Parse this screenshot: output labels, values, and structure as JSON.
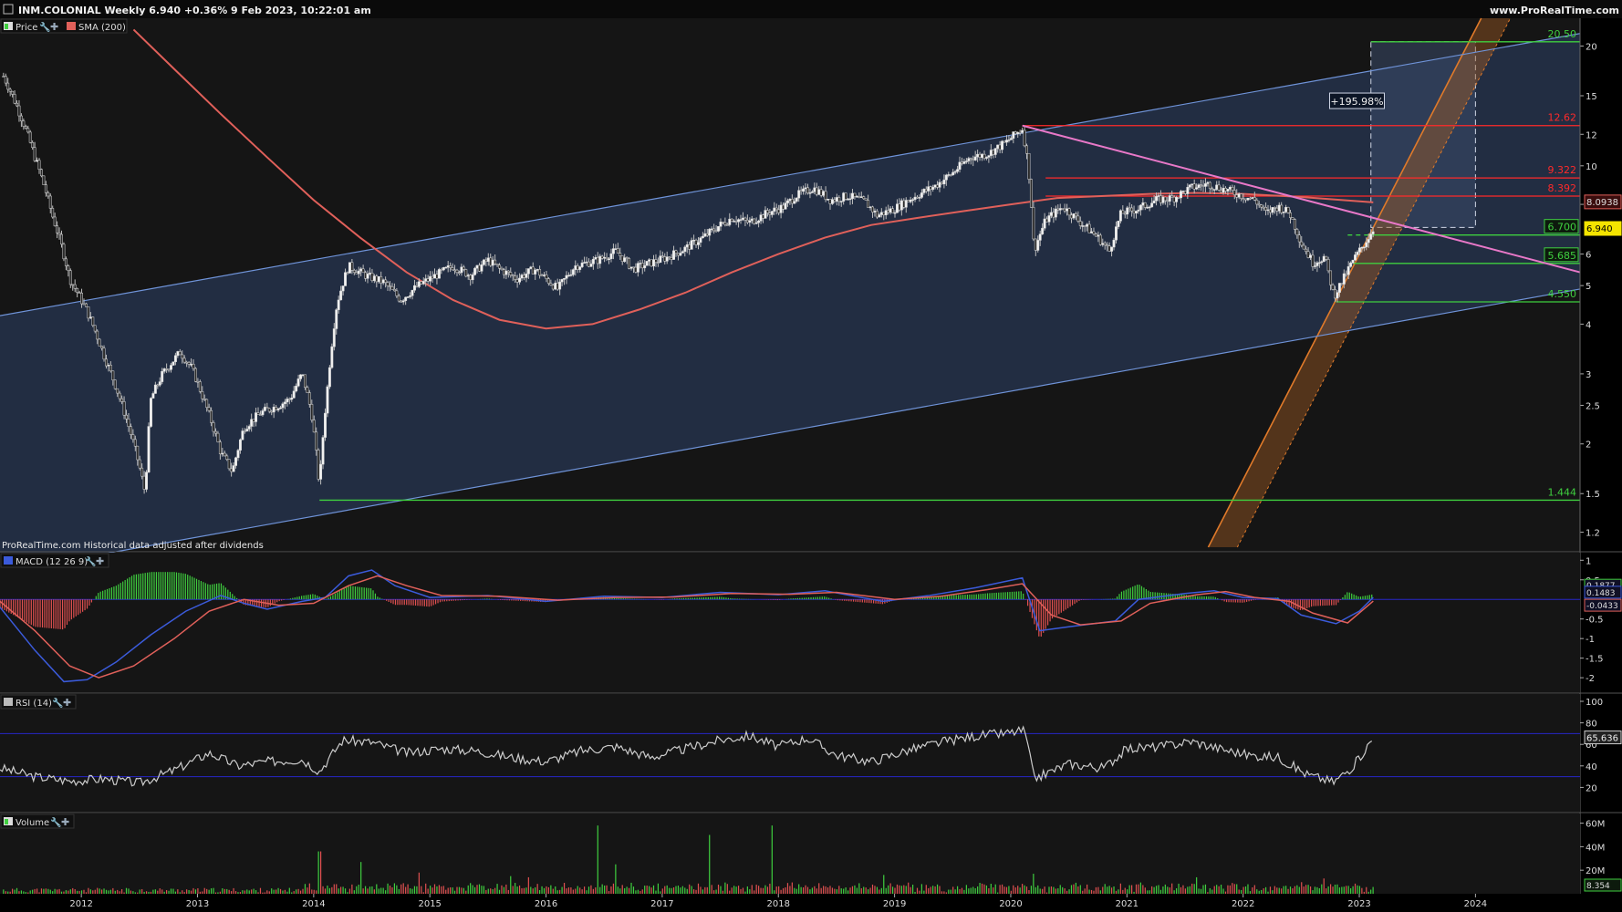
{
  "header": {
    "title": "INM.COLONIAL Weekly 6.940 +0.36% 9 Feb 2023, 10:22:01 am",
    "brand": "www.ProRealTime.com",
    "footnote": "ProRealTime.com  Historical data adjusted after dividends"
  },
  "colors": {
    "background": "#000000",
    "panel": "#151515",
    "channel_fill": "#243047",
    "channel_line": "#6f93d8",
    "sma": "#e0605a",
    "resistance": "#ff2a2a",
    "support": "#3fcf3f",
    "downtrend": "#e878c8",
    "uptrend": "#e07a2a",
    "price": "#e8e8e8",
    "macd": "#3b5bdb",
    "signal": "#e0605a",
    "rsi": "#cccccc",
    "band": "#2626c8"
  },
  "panels": [
    {
      "id": "price",
      "legend": [
        "Price",
        "SMA (200)"
      ]
    },
    {
      "id": "macd",
      "legend": [
        "MACD (12 26 9)"
      ]
    },
    {
      "id": "rsi",
      "legend": [
        "RSI (14)"
      ]
    },
    {
      "id": "volume",
      "legend": [
        "Volume"
      ]
    }
  ],
  "chart_data": [
    {
      "type": "candlestick",
      "panel": "price",
      "scale": "log",
      "ylim": [
        1.1,
        23
      ],
      "y_ticks": [
        1.2,
        1.5,
        2,
        2.5,
        3,
        4,
        5,
        6,
        8,
        10,
        12,
        15,
        20
      ],
      "x_ticks": [
        "2012",
        "2013",
        "2014",
        "2015",
        "2016",
        "2017",
        "2018",
        "2019",
        "2020",
        "2021",
        "2022",
        "2023",
        "2024"
      ],
      "x_range": [
        2011.3,
        2024.9
      ],
      "price_series": [
        [
          2011.33,
          16.8
        ],
        [
          2011.45,
          14.0
        ],
        [
          2011.6,
          10.5
        ],
        [
          2011.75,
          7.5
        ],
        [
          2011.9,
          5.2
        ],
        [
          2012.05,
          4.3
        ],
        [
          2012.2,
          3.3
        ],
        [
          2012.35,
          2.5
        ],
        [
          2012.45,
          2.0
        ],
        [
          2012.55,
          1.5
        ],
        [
          2012.6,
          2.6
        ],
        [
          2012.7,
          3.0
        ],
        [
          2012.85,
          3.4
        ],
        [
          2012.95,
          3.1
        ],
        [
          2013.05,
          2.6
        ],
        [
          2013.2,
          1.9
        ],
        [
          2013.3,
          1.7
        ],
        [
          2013.4,
          2.2
        ],
        [
          2013.55,
          2.4
        ],
        [
          2013.7,
          2.5
        ],
        [
          2013.8,
          2.6
        ],
        [
          2013.9,
          3.0
        ],
        [
          2013.98,
          2.4
        ],
        [
          2014.05,
          1.55
        ],
        [
          2014.12,
          2.8
        ],
        [
          2014.2,
          4.5
        ],
        [
          2014.3,
          5.6
        ],
        [
          2014.45,
          5.3
        ],
        [
          2014.6,
          5.1
        ],
        [
          2014.75,
          4.6
        ],
        [
          2014.9,
          5.0
        ],
        [
          2015.05,
          5.3
        ],
        [
          2015.2,
          5.6
        ],
        [
          2015.35,
          5.3
        ],
        [
          2015.5,
          5.8
        ],
        [
          2015.6,
          5.5
        ],
        [
          2015.75,
          5.2
        ],
        [
          2015.9,
          5.5
        ],
        [
          2016.1,
          4.9
        ],
        [
          2016.25,
          5.6
        ],
        [
          2016.45,
          5.8
        ],
        [
          2016.6,
          6.1
        ],
        [
          2016.75,
          5.5
        ],
        [
          2016.9,
          5.7
        ],
        [
          2017.05,
          5.9
        ],
        [
          2017.2,
          6.2
        ],
        [
          2017.35,
          6.6
        ],
        [
          2017.5,
          7.1
        ],
        [
          2017.6,
          7.4
        ],
        [
          2017.75,
          7.2
        ],
        [
          2017.9,
          7.6
        ],
        [
          2018.05,
          7.9
        ],
        [
          2018.15,
          8.4
        ],
        [
          2018.3,
          8.8
        ],
        [
          2018.45,
          8.2
        ],
        [
          2018.6,
          8.4
        ],
        [
          2018.75,
          8.1
        ],
        [
          2018.85,
          7.5
        ],
        [
          2019.0,
          7.8
        ],
        [
          2019.15,
          8.3
        ],
        [
          2019.35,
          8.9
        ],
        [
          2019.5,
          9.6
        ],
        [
          2019.65,
          10.5
        ],
        [
          2019.8,
          10.7
        ],
        [
          2019.95,
          11.4
        ],
        [
          2020.1,
          12.4
        ],
        [
          2020.15,
          10.0
        ],
        [
          2020.2,
          6.1
        ],
        [
          2020.3,
          7.3
        ],
        [
          2020.45,
          7.9
        ],
        [
          2020.6,
          7.2
        ],
        [
          2020.75,
          6.6
        ],
        [
          2020.85,
          6.1
        ],
        [
          2020.95,
          7.6
        ],
        [
          2021.1,
          7.8
        ],
        [
          2021.25,
          8.2
        ],
        [
          2021.4,
          8.3
        ],
        [
          2021.55,
          8.8
        ],
        [
          2021.7,
          9.0
        ],
        [
          2021.85,
          8.7
        ],
        [
          2022.0,
          8.4
        ],
        [
          2022.1,
          8.2
        ],
        [
          2022.2,
          7.6
        ],
        [
          2022.3,
          7.9
        ],
        [
          2022.4,
          7.6
        ],
        [
          2022.5,
          6.4
        ],
        [
          2022.6,
          5.7
        ],
        [
          2022.7,
          5.9
        ],
        [
          2022.78,
          4.7
        ],
        [
          2022.85,
          5.1
        ],
        [
          2022.95,
          5.8
        ],
        [
          2023.05,
          6.4
        ],
        [
          2023.12,
          6.94
        ]
      ],
      "sma_200": [
        [
          2012.45,
          22.0
        ],
        [
          2012.8,
          17.5
        ],
        [
          2013.2,
          13.5
        ],
        [
          2013.6,
          10.5
        ],
        [
          2014.0,
          8.2
        ],
        [
          2014.4,
          6.6
        ],
        [
          2014.8,
          5.4
        ],
        [
          2015.2,
          4.6
        ],
        [
          2015.6,
          4.1
        ],
        [
          2016.0,
          3.9
        ],
        [
          2016.4,
          4.0
        ],
        [
          2016.8,
          4.35
        ],
        [
          2017.2,
          4.8
        ],
        [
          2017.6,
          5.4
        ],
        [
          2018.0,
          6.0
        ],
        [
          2018.4,
          6.6
        ],
        [
          2018.8,
          7.1
        ],
        [
          2019.2,
          7.4
        ],
        [
          2019.6,
          7.7
        ],
        [
          2020.0,
          8.0
        ],
        [
          2020.4,
          8.3
        ],
        [
          2020.8,
          8.4
        ],
        [
          2021.2,
          8.5
        ],
        [
          2021.6,
          8.55
        ],
        [
          2022.0,
          8.5
        ],
        [
          2022.5,
          8.35
        ],
        [
          2023.12,
          8.0938
        ]
      ],
      "horizontal_levels": [
        {
          "value": 20.5,
          "label": "20.50",
          "kind": "support",
          "from": 2023.1
        },
        {
          "value": 12.62,
          "label": "12.62",
          "kind": "resistance",
          "from": 2020.1
        },
        {
          "value": 9.322,
          "label": "9.322",
          "kind": "resistance",
          "from": 2020.3
        },
        {
          "value": 8.392,
          "label": "8.392",
          "kind": "resistance",
          "from": 2020.3
        },
        {
          "value": 6.7,
          "label": "6.700",
          "kind": "support",
          "from": 2022.9,
          "dashed_until": 2023.1
        },
        {
          "value": 5.685,
          "label": "5.685",
          "kind": "support",
          "from": 2022.95
        },
        {
          "value": 4.55,
          "label": "4.550",
          "kind": "support",
          "from": 2022.8
        },
        {
          "value": 1.444,
          "label": "1.444",
          "kind": "support",
          "from": 2014.05
        }
      ],
      "price_tags": [
        {
          "value": 8.0938,
          "label": "8.0938",
          "style": "sma"
        },
        {
          "value": 6.94,
          "label": "6.940",
          "style": "last"
        }
      ],
      "channel": {
        "upper": [
          [
            2011.3,
            4.2
          ],
          [
            2024.9,
            21.5
          ]
        ],
        "lower": [
          [
            2011.3,
            0.95
          ],
          [
            2024.9,
            4.9
          ]
        ]
      },
      "downtrend_line": [
        [
          2020.1,
          12.62
        ],
        [
          2024.9,
          5.4
        ]
      ],
      "uptrend_band": {
        "left": [
          [
            2021.7,
            1.1
          ],
          [
            2024.05,
            23.5
          ]
        ],
        "right": [
          [
            2021.95,
            1.1
          ],
          [
            2024.3,
            23.5
          ]
        ]
      },
      "target_box": {
        "x0": 2023.1,
        "x1": 2024.0,
        "y0": 7.0,
        "y1": 20.5
      },
      "annotations": [
        {
          "text": "+195.98%",
          "x": 2022.98,
          "y": 14.3
        }
      ]
    },
    {
      "type": "macd",
      "panel": "macd",
      "ylim": [
        -2.3,
        1.1
      ],
      "y_ticks": [
        1,
        0.5,
        -0.5,
        -1,
        -1.5,
        -2
      ],
      "macd": [
        [
          2011.3,
          -0.2
        ],
        [
          2011.6,
          -1.3
        ],
        [
          2011.85,
          -2.1
        ],
        [
          2012.05,
          -2.05
        ],
        [
          2012.3,
          -1.6
        ],
        [
          2012.6,
          -0.9
        ],
        [
          2012.9,
          -0.3
        ],
        [
          2013.2,
          0.1
        ],
        [
          2013.4,
          -0.1
        ],
        [
          2013.6,
          -0.25
        ],
        [
          2013.9,
          -0.05
        ],
        [
          2014.1,
          0.05
        ],
        [
          2014.3,
          0.6
        ],
        [
          2014.5,
          0.75
        ],
        [
          2014.7,
          0.35
        ],
        [
          2015.0,
          0.05
        ],
        [
          2015.5,
          0.1
        ],
        [
          2016.0,
          -0.05
        ],
        [
          2016.5,
          0.08
        ],
        [
          2017.0,
          0.05
        ],
        [
          2017.5,
          0.18
        ],
        [
          2018.0,
          0.12
        ],
        [
          2018.4,
          0.22
        ],
        [
          2018.9,
          -0.05
        ],
        [
          2019.3,
          0.1
        ],
        [
          2019.7,
          0.3
        ],
        [
          2020.1,
          0.55
        ],
        [
          2020.25,
          -0.8
        ],
        [
          2020.5,
          -0.7
        ],
        [
          2020.9,
          -0.55
        ],
        [
          2021.1,
          0.0
        ],
        [
          2021.5,
          0.15
        ],
        [
          2021.75,
          0.22
        ],
        [
          2022.0,
          0.05
        ],
        [
          2022.3,
          0.02
        ],
        [
          2022.5,
          -0.4
        ],
        [
          2022.8,
          -0.62
        ],
        [
          2023.0,
          -0.3
        ],
        [
          2023.12,
          0.05
        ]
      ],
      "signal": [
        [
          2011.3,
          -0.05
        ],
        [
          2011.6,
          -0.8
        ],
        [
          2011.9,
          -1.7
        ],
        [
          2012.15,
          -2.0
        ],
        [
          2012.45,
          -1.7
        ],
        [
          2012.8,
          -1.0
        ],
        [
          2013.1,
          -0.3
        ],
        [
          2013.4,
          0.0
        ],
        [
          2013.7,
          -0.15
        ],
        [
          2014.0,
          -0.1
        ],
        [
          2014.3,
          0.35
        ],
        [
          2014.55,
          0.6
        ],
        [
          2014.8,
          0.35
        ],
        [
          2015.1,
          0.1
        ],
        [
          2015.6,
          0.08
        ],
        [
          2016.1,
          -0.02
        ],
        [
          2016.6,
          0.05
        ],
        [
          2017.1,
          0.06
        ],
        [
          2017.6,
          0.15
        ],
        [
          2018.1,
          0.13
        ],
        [
          2018.5,
          0.18
        ],
        [
          2019.0,
          0.0
        ],
        [
          2019.4,
          0.08
        ],
        [
          2019.8,
          0.25
        ],
        [
          2020.1,
          0.4
        ],
        [
          2020.35,
          -0.4
        ],
        [
          2020.6,
          -0.65
        ],
        [
          2020.95,
          -0.55
        ],
        [
          2021.2,
          -0.1
        ],
        [
          2021.6,
          0.12
        ],
        [
          2021.85,
          0.2
        ],
        [
          2022.1,
          0.05
        ],
        [
          2022.4,
          -0.05
        ],
        [
          2022.6,
          -0.35
        ],
        [
          2022.9,
          -0.6
        ],
        [
          2023.12,
          -0.0433
        ]
      ],
      "labels": [
        "0.1877",
        "0.1483",
        "-0.0433"
      ]
    },
    {
      "type": "rsi",
      "panel": "rsi",
      "ylim": [
        0,
        100
      ],
      "y_ticks": [
        100,
        80,
        60,
        40,
        20
      ],
      "bands": [
        70,
        30
      ],
      "rsi": [
        [
          2011.3,
          38
        ],
        [
          2011.6,
          30
        ],
        [
          2011.9,
          26
        ],
        [
          2012.2,
          28
        ],
        [
          2012.5,
          24
        ],
        [
          2012.8,
          36
        ],
        [
          2013.1,
          52
        ],
        [
          2013.35,
          40
        ],
        [
          2013.6,
          44
        ],
        [
          2013.9,
          46
        ],
        [
          2014.05,
          35
        ],
        [
          2014.25,
          64
        ],
        [
          2014.5,
          62
        ],
        [
          2014.8,
          52
        ],
        [
          2015.1,
          56
        ],
        [
          2015.4,
          54
        ],
        [
          2015.7,
          48
        ],
        [
          2016.0,
          44
        ],
        [
          2016.3,
          54
        ],
        [
          2016.6,
          58
        ],
        [
          2016.9,
          48
        ],
        [
          2017.2,
          56
        ],
        [
          2017.5,
          64
        ],
        [
          2017.75,
          68
        ],
        [
          2018.0,
          58
        ],
        [
          2018.25,
          66
        ],
        [
          2018.5,
          50
        ],
        [
          2018.8,
          44
        ],
        [
          2019.1,
          54
        ],
        [
          2019.4,
          62
        ],
        [
          2019.7,
          68
        ],
        [
          2019.95,
          70
        ],
        [
          2020.12,
          73
        ],
        [
          2020.2,
          28
        ],
        [
          2020.5,
          42
        ],
        [
          2020.8,
          38
        ],
        [
          2021.0,
          56
        ],
        [
          2021.3,
          58
        ],
        [
          2021.55,
          63
        ],
        [
          2021.8,
          56
        ],
        [
          2022.05,
          50
        ],
        [
          2022.3,
          48
        ],
        [
          2022.55,
          32
        ],
        [
          2022.78,
          25
        ],
        [
          2022.95,
          40
        ],
        [
          2023.12,
          65.636
        ]
      ],
      "labels": [
        "65.636"
      ]
    },
    {
      "type": "bar",
      "panel": "volume",
      "ylim": [
        0,
        62
      ],
      "y_ticks_labels": [
        "60M",
        "40M",
        "20M"
      ],
      "y_ticks_values": [
        60,
        40,
        20
      ],
      "spikes": [
        [
          2014.05,
          36
        ],
        [
          2014.4,
          27
        ],
        [
          2014.9,
          18
        ],
        [
          2015.7,
          15
        ],
        [
          2015.85,
          14
        ],
        [
          2016.45,
          58
        ],
        [
          2016.6,
          25
        ],
        [
          2017.4,
          50
        ],
        [
          2017.95,
          58
        ],
        [
          2018.9,
          16
        ],
        [
          2020.2,
          17
        ],
        [
          2021.6,
          14
        ],
        [
          2022.7,
          13
        ]
      ],
      "labels": [
        "8.354"
      ]
    }
  ]
}
